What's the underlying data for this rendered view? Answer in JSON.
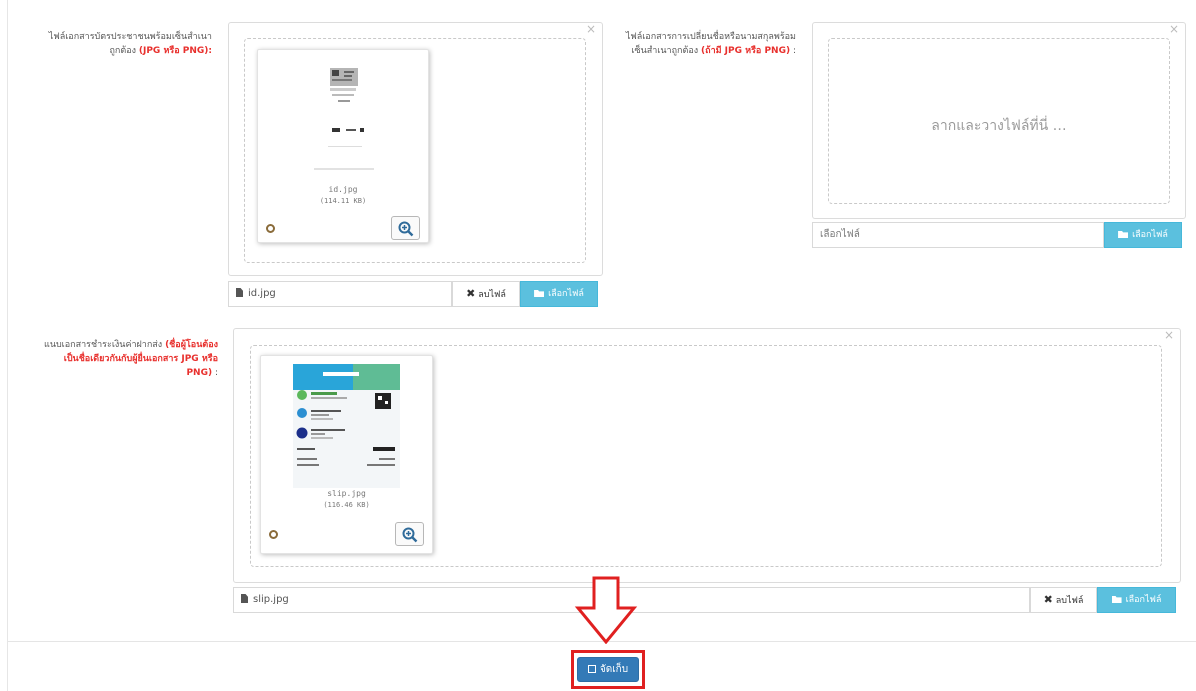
{
  "id_card": {
    "label_main": "ไฟล์เอกสารบัตรประชาชนพร้อมเซ็นสำเนาถูกต้อง",
    "label_req": "(JPG หรือ PNG):",
    "file_name": "id.jpg",
    "file_size": "(114.11 KB)",
    "bar_file_name": "id.jpg",
    "delete_label": "ลบไฟล์",
    "pick_label": "เลือกไฟล์"
  },
  "name_change": {
    "label_main": "ไฟล์เอกสารการเปลี่ยนชื่อหรือนามสกุลพร้อมเซ็นสำเนาถูกต้อง",
    "label_req": "(ถ้ามี JPG หรือ PNG)",
    "label_tail": " :",
    "drop_text": "ลากและวางไฟล์ที่นี่ …",
    "placeholder": "เลือกไฟล์",
    "pick_label": "เลือกไฟล์"
  },
  "payment_slip": {
    "label_main": "แนบเอกสารชำระเงินค่าฝากส่ง",
    "label_req": "(ชื่อผู้โอนต้องเป็นชื่อเดียวกันกับผู้ยื่นเอกสาร JPG หรือ PNG)",
    "label_tail": " :",
    "file_name": "slip.jpg",
    "file_size": "(116.46 KB)",
    "bar_file_name": "slip.jpg",
    "delete_label": "ลบไฟล์",
    "pick_label": "เลือกไฟล์"
  },
  "save_label": "จัดเก็บ",
  "colors": {
    "info": "#5bc0de",
    "primary": "#337ab7",
    "required": "#e8302d",
    "annotation": "#e02020"
  }
}
